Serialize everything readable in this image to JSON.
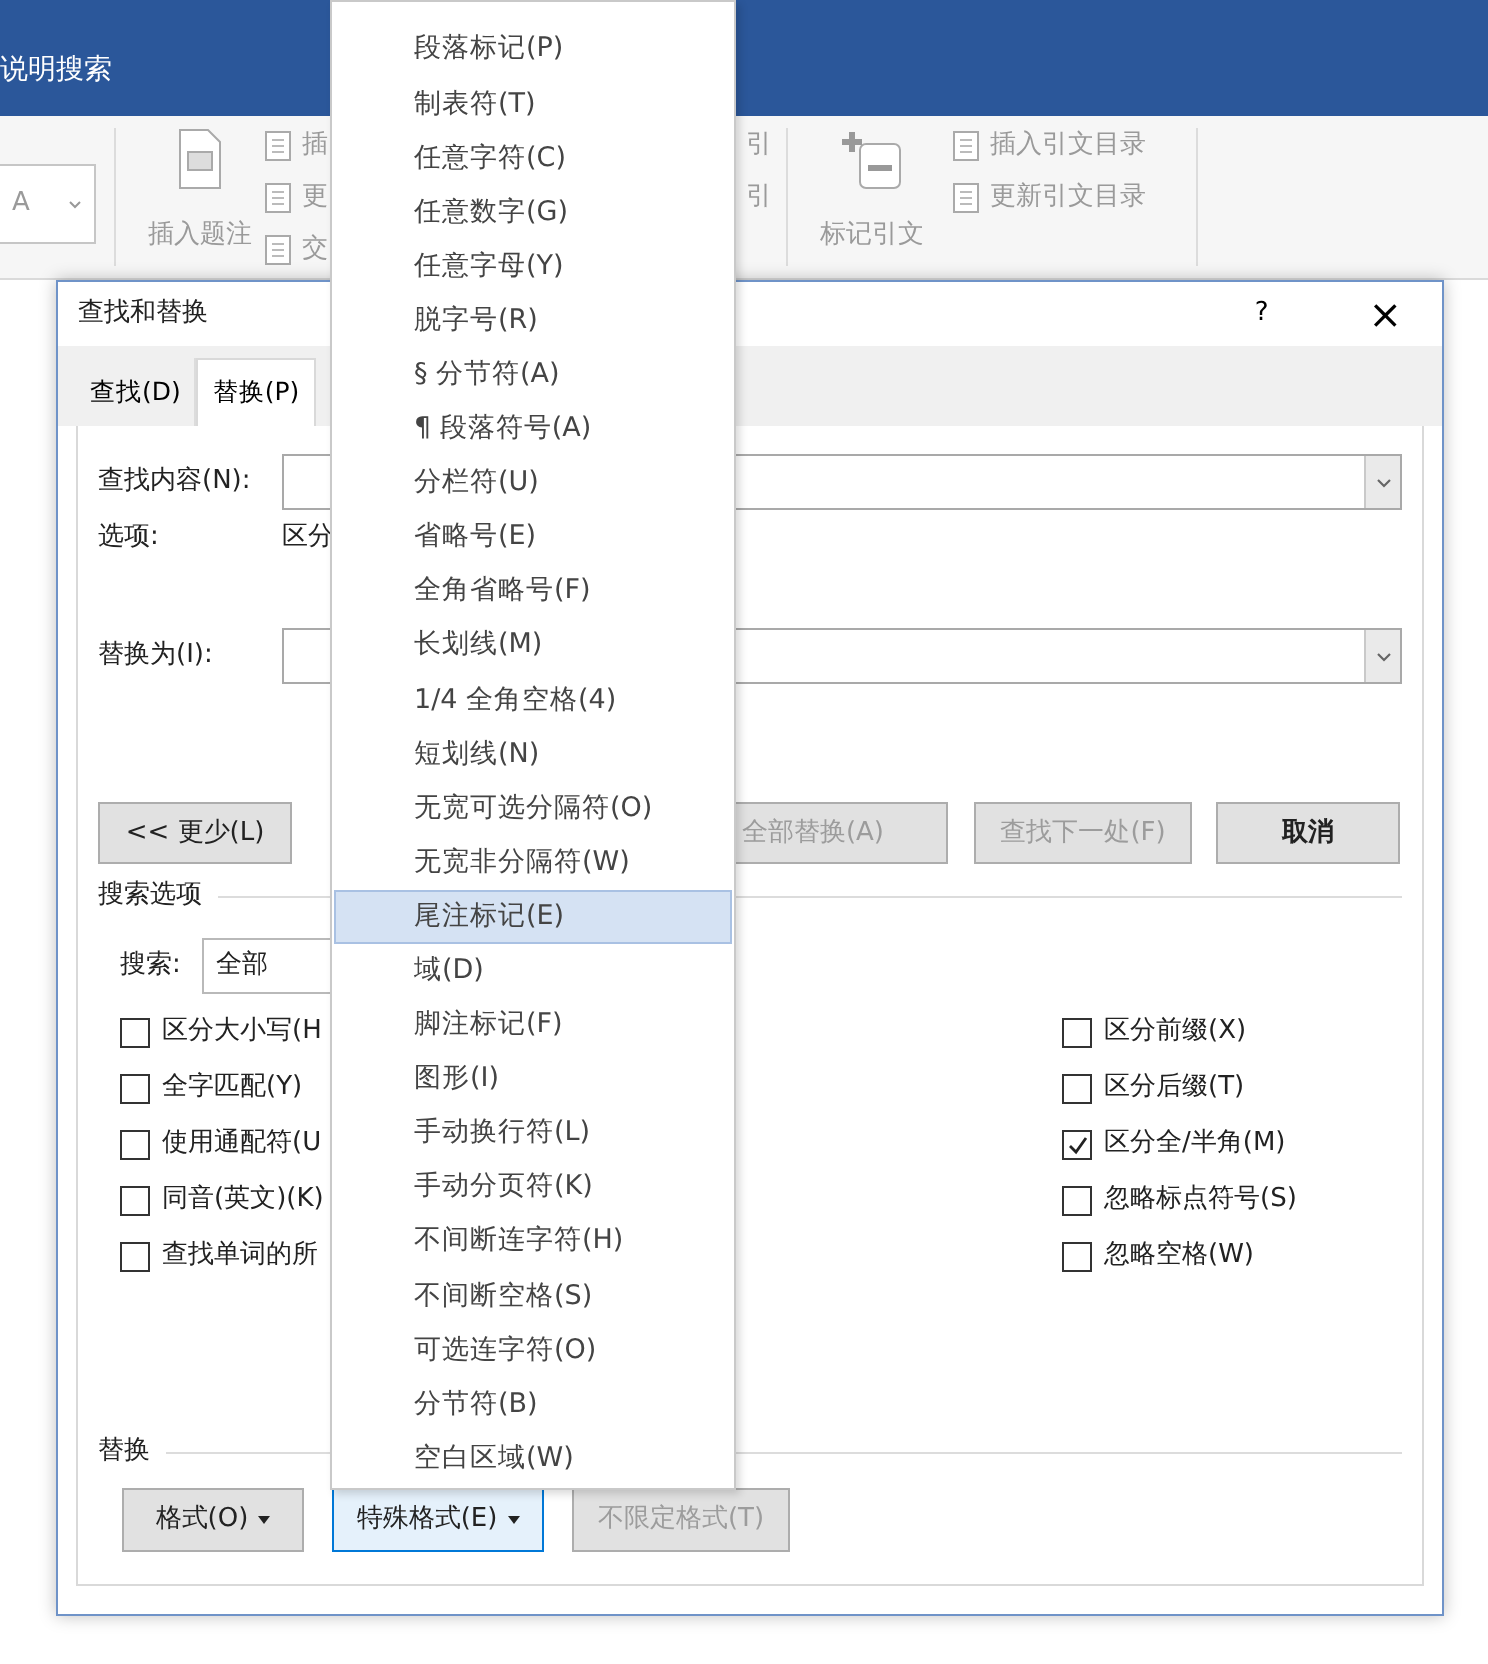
{
  "title_bar": {
    "search_label": "说明搜索"
  },
  "ribbon": {
    "style_box": "A",
    "insert_caption": "插入题注",
    "caption_small_buttons": [
      "插",
      "更",
      "交"
    ],
    "index_fragments": [
      "引",
      "引"
    ],
    "mark_citation": "标记引文",
    "citation_buttons": [
      "插入引文目录",
      "更新引文目录"
    ]
  },
  "dialog": {
    "title": "查找和替换",
    "help": "?",
    "close": "×",
    "tabs": [
      {
        "label": "查找(D)",
        "selected": false
      },
      {
        "label": "替换(P)",
        "selected": true
      }
    ],
    "find_label": "查找内容(N):",
    "options_label": "选项:",
    "options_value": "区分",
    "replace_label": "替换为(I):",
    "buttons": [
      {
        "label": "<< 更少(L)",
        "disabled": false
      },
      {
        "label": "全部替换(A)",
        "disabled": true
      },
      {
        "label": "查找下一处(F)",
        "disabled": true
      },
      {
        "label": "取消",
        "disabled": false
      }
    ],
    "search_options_heading": "搜索选项",
    "search_label": "搜索:",
    "search_value": "全部",
    "checkboxes_left": [
      {
        "label": "区分大小写(H",
        "checked": false
      },
      {
        "label": "全字匹配(Y)",
        "checked": false
      },
      {
        "label": "使用通配符(U",
        "checked": false
      },
      {
        "label": "同音(英文)(K)",
        "checked": false
      },
      {
        "label": "查找单词的所",
        "checked": false
      }
    ],
    "checkboxes_right": [
      {
        "label": "区分前缀(X)",
        "checked": false
      },
      {
        "label": "区分后缀(T)",
        "checked": false
      },
      {
        "label": "区分全/半角(M)",
        "checked": true
      },
      {
        "label": "忽略标点符号(S)",
        "checked": false
      },
      {
        "label": "忽略空格(W)",
        "checked": false
      }
    ],
    "replace_heading": "替换",
    "format_buttons": [
      {
        "label": "格式(O)",
        "dropdown": true,
        "pressed": false,
        "disabled": false
      },
      {
        "label": "特殊格式(E)",
        "dropdown": true,
        "pressed": true,
        "disabled": false
      },
      {
        "label": "不限定格式(T)",
        "dropdown": false,
        "pressed": false,
        "disabled": true
      }
    ]
  },
  "special_menu": {
    "items": [
      {
        "label": "段落标记(P)",
        "selected": false
      },
      {
        "label": "制表符(T)",
        "selected": false
      },
      {
        "label": "任意字符(C)",
        "selected": false
      },
      {
        "label": "任意数字(G)",
        "selected": false
      },
      {
        "label": "任意字母(Y)",
        "selected": false
      },
      {
        "label": "脱字号(R)",
        "selected": false
      },
      {
        "label": "§ 分节符(A)",
        "selected": false
      },
      {
        "label": "¶ 段落符号(A)",
        "selected": false
      },
      {
        "label": "分栏符(U)",
        "selected": false
      },
      {
        "label": "省略号(E)",
        "selected": false
      },
      {
        "label": "全角省略号(F)",
        "selected": false
      },
      {
        "label": "长划线(M)",
        "selected": false
      },
      {
        "label": "1/4 全角空格(4)",
        "selected": false
      },
      {
        "label": "短划线(N)",
        "selected": false
      },
      {
        "label": "无宽可选分隔符(O)",
        "selected": false
      },
      {
        "label": "无宽非分隔符(W)",
        "selected": false
      },
      {
        "label": "尾注标记(E)",
        "selected": true
      },
      {
        "label": "域(D)",
        "selected": false
      },
      {
        "label": "脚注标记(F)",
        "selected": false
      },
      {
        "label": "图形(I)",
        "selected": false
      },
      {
        "label": "手动换行符(L)",
        "selected": false
      },
      {
        "label": "手动分页符(K)",
        "selected": false
      },
      {
        "label": "不间断连字符(H)",
        "selected": false
      },
      {
        "label": "不间断空格(S)",
        "selected": false
      },
      {
        "label": "可选连字符(O)",
        "selected": false
      },
      {
        "label": "分节符(B)",
        "selected": false
      },
      {
        "label": "空白区域(W)",
        "selected": false
      }
    ]
  }
}
